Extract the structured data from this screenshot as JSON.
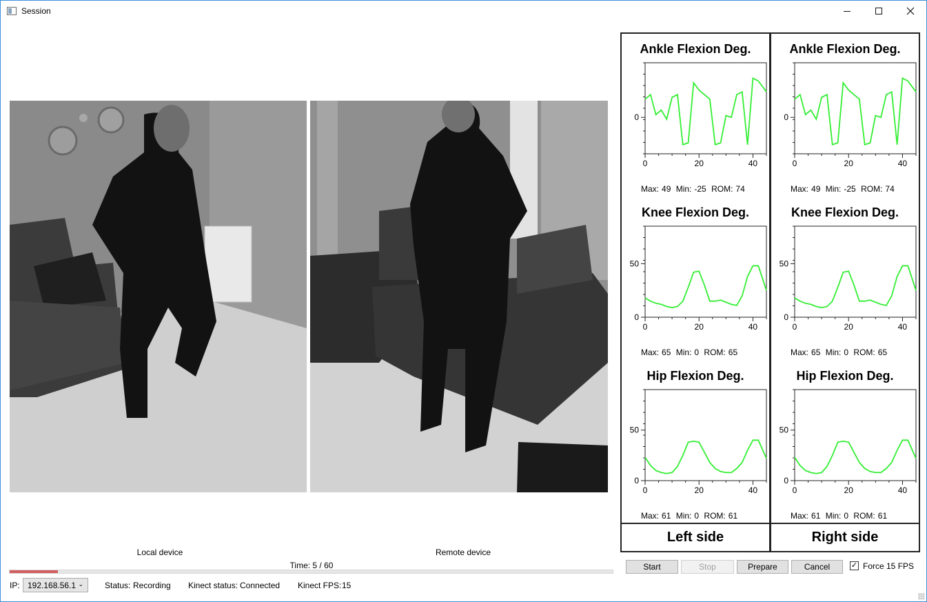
{
  "window": {
    "title": "Session"
  },
  "video": {
    "local_label": "Local device",
    "remote_label": "Remote device"
  },
  "time": {
    "label": "Time: 5 / 60",
    "progress": 0.08
  },
  "status_bar": {
    "ip_label": "IP:",
    "ip_value": "192.168.56.1",
    "status_label": "Status:",
    "status_value": "Recording",
    "kinect_status_label": "Kinect status:",
    "kinect_status_value": "Connected",
    "kinect_fps_label": "Kinect FPS:",
    "kinect_fps_value": "15"
  },
  "colors": {
    "series": "#33ee33",
    "progress": "#d05e5e"
  },
  "panels": [
    {
      "side_label": "Left side",
      "charts": [
        {
          "title": "Ankle Flexion Deg.",
          "max": "49",
          "min": "-25",
          "rom": "74"
        },
        {
          "title": "Knee Flexion Deg.",
          "max": "65",
          "min": "0",
          "rom": "65"
        },
        {
          "title": "Hip Flexion Deg.",
          "max": "61",
          "min": "0",
          "rom": "61"
        }
      ]
    },
    {
      "side_label": "Right side",
      "charts": [
        {
          "title": "Ankle Flexion Deg.",
          "max": "49",
          "min": "-25",
          "rom": "74"
        },
        {
          "title": "Knee Flexion Deg.",
          "max": "65",
          "min": "0",
          "rom": "65"
        },
        {
          "title": "Hip Flexion Deg.",
          "max": "61",
          "min": "0",
          "rom": "61"
        }
      ]
    }
  ],
  "stat_labels": {
    "max": "Max:",
    "min": "Min:",
    "rom": "ROM:"
  },
  "buttons": {
    "start": "Start",
    "stop": "Stop",
    "prepare": "Prepare",
    "cancel": "Cancel"
  },
  "force_fps": {
    "label": "Force 15 FPS",
    "checked": true
  },
  "chart_data": [
    {
      "type": "line",
      "title": "Ankle Flexion Deg.",
      "xlim": [
        0,
        45
      ],
      "ylim": [
        -40,
        60
      ],
      "xticks": [
        0,
        20,
        40
      ],
      "yticks": [
        0
      ],
      "x": [
        0,
        2,
        4,
        6,
        8,
        10,
        12,
        14,
        16,
        18,
        20,
        24,
        26,
        28,
        30,
        32,
        34,
        36,
        38,
        40,
        42,
        45
      ],
      "y": [
        20,
        25,
        3,
        8,
        -2,
        22,
        25,
        -30,
        -28,
        38,
        30,
        20,
        -30,
        -28,
        2,
        0,
        25,
        28,
        -30,
        43,
        40,
        28
      ]
    },
    {
      "type": "line",
      "title": "Knee Flexion Deg.",
      "xlim": [
        0,
        45
      ],
      "ylim": [
        0,
        85
      ],
      "xticks": [
        0,
        20,
        40
      ],
      "yticks": [
        0,
        50
      ],
      "x": [
        0,
        2,
        4,
        6,
        8,
        10,
        12,
        14,
        16,
        18,
        20,
        22,
        24,
        26,
        28,
        30,
        32,
        34,
        36,
        38,
        40,
        42,
        45
      ],
      "y": [
        18,
        15,
        13,
        12,
        10,
        9,
        10,
        15,
        28,
        42,
        43,
        30,
        15,
        15,
        16,
        14,
        12,
        11,
        20,
        38,
        48,
        48,
        25
      ]
    },
    {
      "type": "line",
      "title": "Hip Flexion Deg.",
      "xlim": [
        0,
        45
      ],
      "ylim": [
        0,
        90
      ],
      "xticks": [
        0,
        20,
        40
      ],
      "yticks": [
        0,
        50
      ],
      "x": [
        0,
        2,
        4,
        6,
        8,
        10,
        12,
        14,
        16,
        18,
        20,
        22,
        24,
        26,
        28,
        30,
        32,
        34,
        36,
        38,
        40,
        42,
        45
      ],
      "y": [
        23,
        15,
        10,
        8,
        7,
        8,
        14,
        25,
        38,
        39,
        38,
        28,
        18,
        12,
        9,
        8,
        8,
        12,
        18,
        30,
        40,
        40,
        22
      ]
    }
  ]
}
